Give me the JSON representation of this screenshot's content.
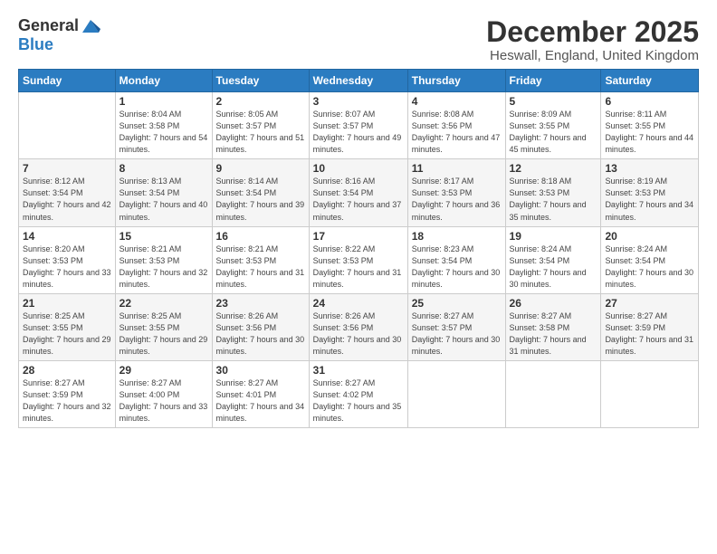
{
  "header": {
    "logo_line1": "General",
    "logo_line2": "Blue",
    "title": "December 2025",
    "subtitle": "Heswall, England, United Kingdom"
  },
  "days_of_week": [
    "Sunday",
    "Monday",
    "Tuesday",
    "Wednesday",
    "Thursday",
    "Friday",
    "Saturday"
  ],
  "weeks": [
    [
      {
        "day": "",
        "info": ""
      },
      {
        "day": "1",
        "info": "Sunrise: 8:04 AM\nSunset: 3:58 PM\nDaylight: 7 hours\nand 54 minutes."
      },
      {
        "day": "2",
        "info": "Sunrise: 8:05 AM\nSunset: 3:57 PM\nDaylight: 7 hours\nand 51 minutes."
      },
      {
        "day": "3",
        "info": "Sunrise: 8:07 AM\nSunset: 3:57 PM\nDaylight: 7 hours\nand 49 minutes."
      },
      {
        "day": "4",
        "info": "Sunrise: 8:08 AM\nSunset: 3:56 PM\nDaylight: 7 hours\nand 47 minutes."
      },
      {
        "day": "5",
        "info": "Sunrise: 8:09 AM\nSunset: 3:55 PM\nDaylight: 7 hours\nand 45 minutes."
      },
      {
        "day": "6",
        "info": "Sunrise: 8:11 AM\nSunset: 3:55 PM\nDaylight: 7 hours\nand 44 minutes."
      }
    ],
    [
      {
        "day": "7",
        "info": "Sunrise: 8:12 AM\nSunset: 3:54 PM\nDaylight: 7 hours\nand 42 minutes."
      },
      {
        "day": "8",
        "info": "Sunrise: 8:13 AM\nSunset: 3:54 PM\nDaylight: 7 hours\nand 40 minutes."
      },
      {
        "day": "9",
        "info": "Sunrise: 8:14 AM\nSunset: 3:54 PM\nDaylight: 7 hours\nand 39 minutes."
      },
      {
        "day": "10",
        "info": "Sunrise: 8:16 AM\nSunset: 3:54 PM\nDaylight: 7 hours\nand 37 minutes."
      },
      {
        "day": "11",
        "info": "Sunrise: 8:17 AM\nSunset: 3:53 PM\nDaylight: 7 hours\nand 36 minutes."
      },
      {
        "day": "12",
        "info": "Sunrise: 8:18 AM\nSunset: 3:53 PM\nDaylight: 7 hours\nand 35 minutes."
      },
      {
        "day": "13",
        "info": "Sunrise: 8:19 AM\nSunset: 3:53 PM\nDaylight: 7 hours\nand 34 minutes."
      }
    ],
    [
      {
        "day": "14",
        "info": "Sunrise: 8:20 AM\nSunset: 3:53 PM\nDaylight: 7 hours\nand 33 minutes."
      },
      {
        "day": "15",
        "info": "Sunrise: 8:21 AM\nSunset: 3:53 PM\nDaylight: 7 hours\nand 32 minutes."
      },
      {
        "day": "16",
        "info": "Sunrise: 8:21 AM\nSunset: 3:53 PM\nDaylight: 7 hours\nand 31 minutes."
      },
      {
        "day": "17",
        "info": "Sunrise: 8:22 AM\nSunset: 3:53 PM\nDaylight: 7 hours\nand 31 minutes."
      },
      {
        "day": "18",
        "info": "Sunrise: 8:23 AM\nSunset: 3:54 PM\nDaylight: 7 hours\nand 30 minutes."
      },
      {
        "day": "19",
        "info": "Sunrise: 8:24 AM\nSunset: 3:54 PM\nDaylight: 7 hours\nand 30 minutes."
      },
      {
        "day": "20",
        "info": "Sunrise: 8:24 AM\nSunset: 3:54 PM\nDaylight: 7 hours\nand 30 minutes."
      }
    ],
    [
      {
        "day": "21",
        "info": "Sunrise: 8:25 AM\nSunset: 3:55 PM\nDaylight: 7 hours\nand 29 minutes."
      },
      {
        "day": "22",
        "info": "Sunrise: 8:25 AM\nSunset: 3:55 PM\nDaylight: 7 hours\nand 29 minutes."
      },
      {
        "day": "23",
        "info": "Sunrise: 8:26 AM\nSunset: 3:56 PM\nDaylight: 7 hours\nand 30 minutes."
      },
      {
        "day": "24",
        "info": "Sunrise: 8:26 AM\nSunset: 3:56 PM\nDaylight: 7 hours\nand 30 minutes."
      },
      {
        "day": "25",
        "info": "Sunrise: 8:27 AM\nSunset: 3:57 PM\nDaylight: 7 hours\nand 30 minutes."
      },
      {
        "day": "26",
        "info": "Sunrise: 8:27 AM\nSunset: 3:58 PM\nDaylight: 7 hours\nand 31 minutes."
      },
      {
        "day": "27",
        "info": "Sunrise: 8:27 AM\nSunset: 3:59 PM\nDaylight: 7 hours\nand 31 minutes."
      }
    ],
    [
      {
        "day": "28",
        "info": "Sunrise: 8:27 AM\nSunset: 3:59 PM\nDaylight: 7 hours\nand 32 minutes."
      },
      {
        "day": "29",
        "info": "Sunrise: 8:27 AM\nSunset: 4:00 PM\nDaylight: 7 hours\nand 33 minutes."
      },
      {
        "day": "30",
        "info": "Sunrise: 8:27 AM\nSunset: 4:01 PM\nDaylight: 7 hours\nand 34 minutes."
      },
      {
        "day": "31",
        "info": "Sunrise: 8:27 AM\nSunset: 4:02 PM\nDaylight: 7 hours\nand 35 minutes."
      },
      {
        "day": "",
        "info": ""
      },
      {
        "day": "",
        "info": ""
      },
      {
        "day": "",
        "info": ""
      }
    ]
  ]
}
